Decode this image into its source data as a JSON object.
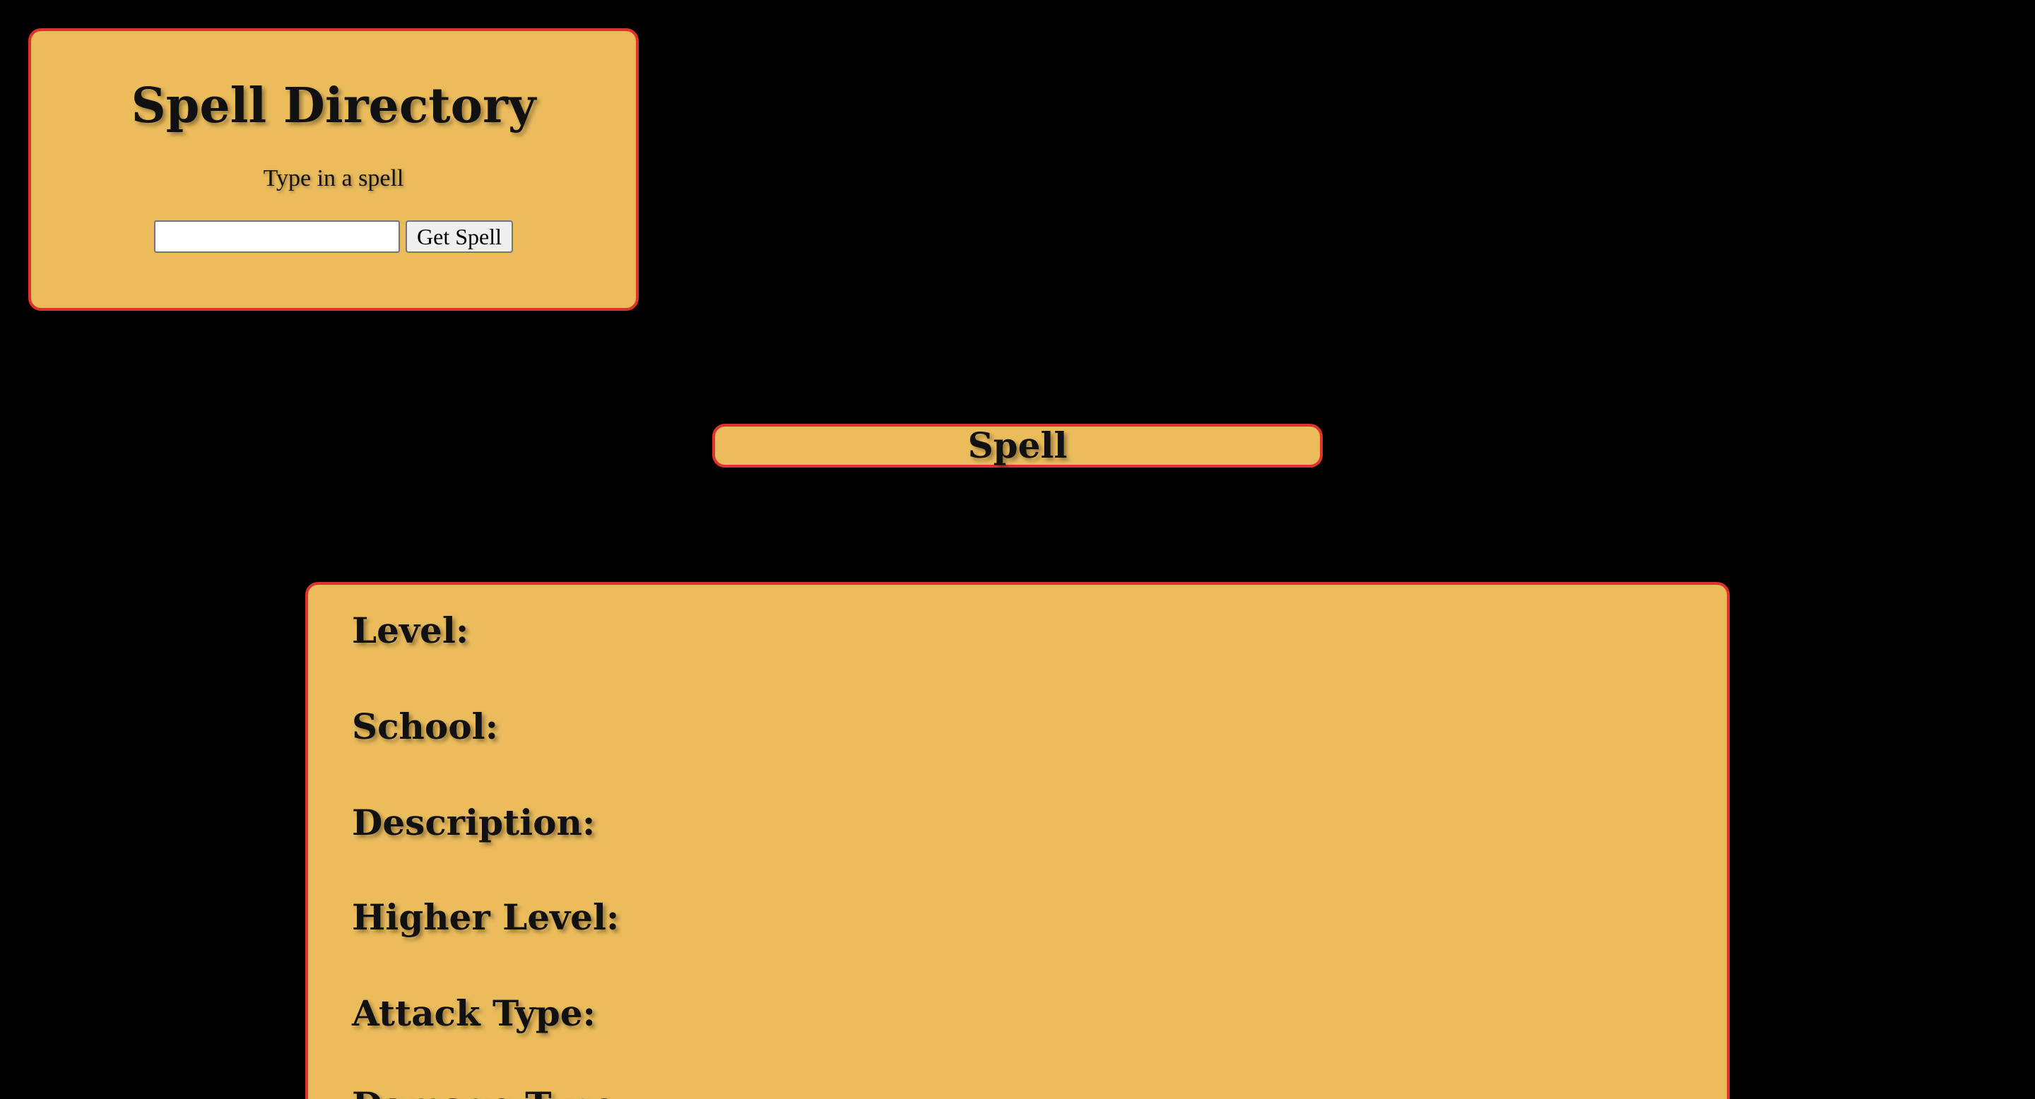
{
  "search": {
    "title": "Spell Directory",
    "prompt": "Type in a spell",
    "input_value": "",
    "input_placeholder": "",
    "button_label": "Get Spell"
  },
  "spell": {
    "name": "Spell"
  },
  "details": {
    "fields": [
      {
        "label": "Level:"
      },
      {
        "label": "School:"
      },
      {
        "label": "Description:"
      },
      {
        "label": "Higher Level:"
      },
      {
        "label": "Attack Type:"
      },
      {
        "label": "Damage Type:"
      }
    ]
  },
  "colors": {
    "background": "#000000",
    "panel": "#ebbc5c",
    "border": "#e0322c",
    "text": "#111111"
  }
}
